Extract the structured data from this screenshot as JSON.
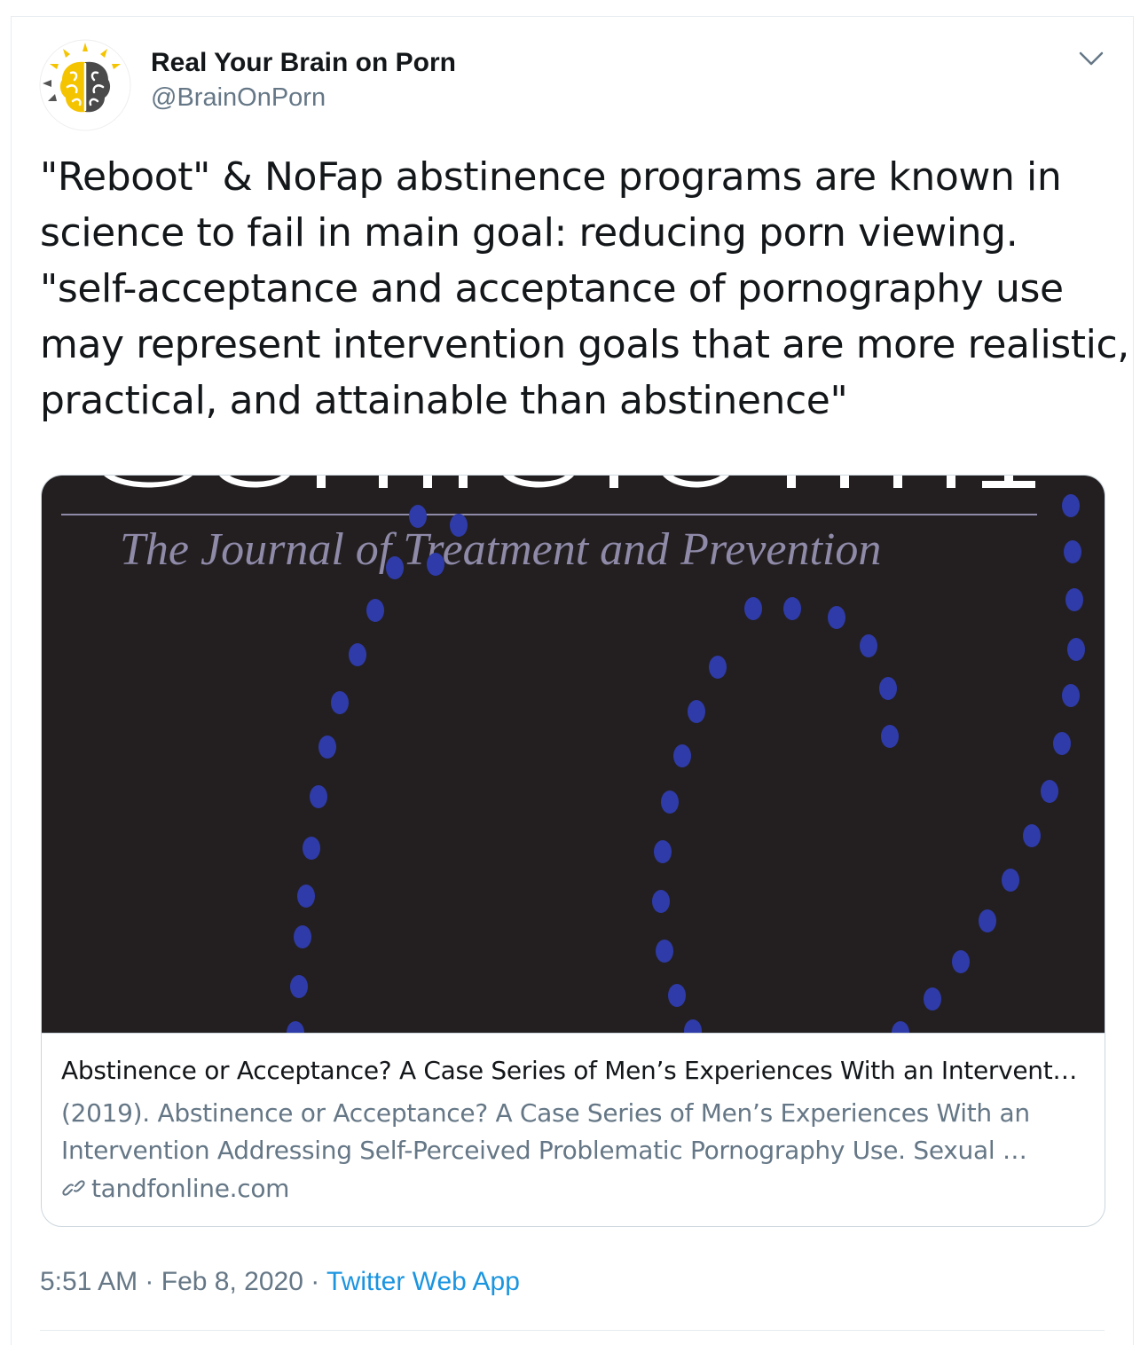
{
  "author": {
    "display_name": "Real Your Brain on Porn",
    "handle": "@BrainOnPorn",
    "avatar_icon": "brain-sun-logo-icon"
  },
  "menu": {
    "icon": "chevron-down-icon"
  },
  "tweet": {
    "lines": [
      "\"Reboot\" & NoFap abstinence programs are known in",
      "science to fail in main goal: reducing porn viewing.",
      "\"self-acceptance and acceptance of pornography use",
      "may represent intervention goals that are more realistic,",
      "practical, and attainable than abstinence\""
    ]
  },
  "card": {
    "image_heading": "The Journal of Treatment and Prevention",
    "title": "Abstinence or Acceptance? A Case Series of Men’s Experiences With an Intervent…",
    "description_lines": [
      "(2019). Abstinence or Acceptance? A Case Series of Men’s Experiences With an",
      "Intervention Addressing Self-Perceived Problematic Pornography Use. Sexual …"
    ],
    "domain": "tandfonline.com",
    "link_icon": "link-icon",
    "colors": {
      "image_background": "#231f20",
      "dot_color": "#2f3ba8",
      "heading_color": "#8f8aa8"
    }
  },
  "meta": {
    "time": "5:51 AM",
    "separator": " · ",
    "date": "Feb 8, 2020",
    "separator2": " · ",
    "source": "Twitter Web App"
  },
  "colors": {
    "text_primary": "#14171a",
    "text_secondary": "#657786",
    "link": "#1b95e0",
    "border": "#ccd6dd"
  }
}
